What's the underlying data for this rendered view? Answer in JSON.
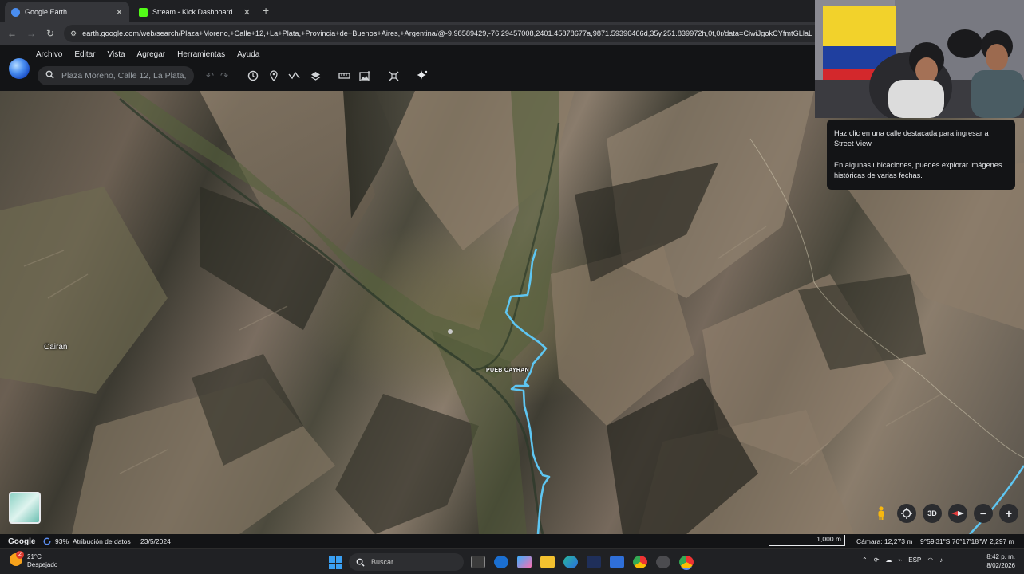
{
  "browser": {
    "tabs": [
      {
        "title": "Google Earth",
        "fav_color": "#4a8ef0",
        "active": true
      },
      {
        "title": "Stream - Kick Dashboard",
        "fav_color": "#53fc18",
        "active": false
      }
    ],
    "url": "earth.google.com/web/search/Plaza+Moreno,+Calle+12,+La+Plata,+Provincia+de+Buenos+Aires,+Argentina/@-9.98589429,-76.29457008,2401.45878677a,9871.59396466d,35y,251.839972h,0t,0r/data=CiwiJgokCYfmtGLlaL"
  },
  "app": {
    "menu": [
      "Archivo",
      "Editar",
      "Vista",
      "Agregar",
      "Herramientas",
      "Ayuda"
    ],
    "search_value": "Plaza Moreno, Calle 12, La Plata,",
    "toolbar_icons": [
      "undo-icon",
      "redo-icon",
      "history-icon",
      "placemark-icon",
      "path-icon",
      "layers-icon",
      "ruler-icon",
      "image-icon",
      "project-icon",
      "sparkle-icon"
    ]
  },
  "map": {
    "labels": {
      "cairan": "Cairan",
      "pueb": "PUEB CAYRAN"
    },
    "route_color": "#5ec6f2"
  },
  "tooltip": {
    "line1": "Haz clic en una calle destacada para ingresar a Street View.",
    "line2": "En algunas ubicaciones, puedes explorar imágenes históricas de varias fechas."
  },
  "controls": {
    "mode_3d": "3D"
  },
  "status": {
    "brand": "Google",
    "load_pct": "93%",
    "attribution": "Atribución de datos",
    "date": "23/5/2024",
    "scale": "1,000 m",
    "camera": "Cámara: 12,273 m",
    "coords": "9°59'31\"S 76°17'18\"W",
    "altitude": "2,297 m"
  },
  "taskbar": {
    "weather_temp": "21°C",
    "weather_desc": "Despejado",
    "notif_count": "2",
    "search_placeholder": "Buscar",
    "lang": "ESP",
    "time": "8:42 p. m.",
    "date": "8/02/2026"
  }
}
